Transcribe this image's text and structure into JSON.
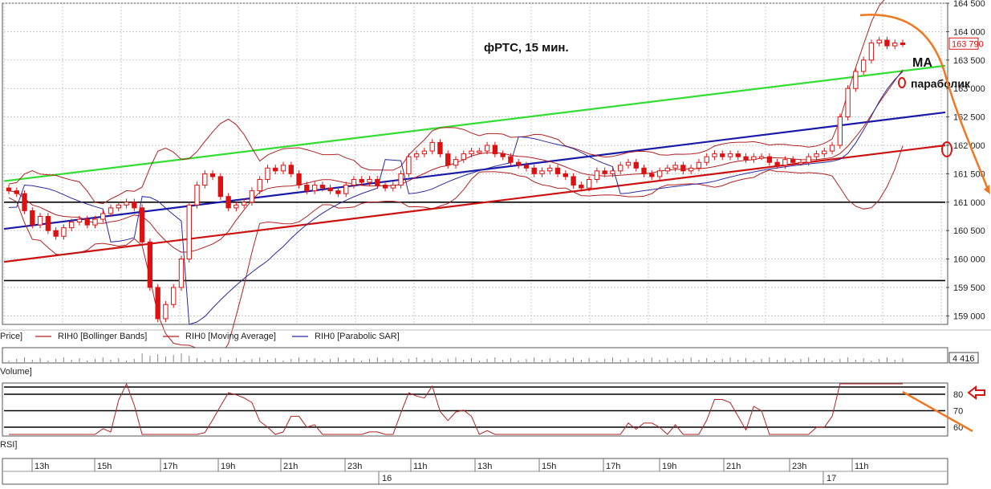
{
  "title": "фРТС,  15 мин.",
  "annotations": {
    "ma": "MA",
    "parabolic": "параболик"
  },
  "last_price_label": "163 790",
  "volume_value": "4 416",
  "panel_labels": {
    "price": "Price]",
    "volume": "Volume]",
    "rsi": "RSI]"
  },
  "legend": [
    {
      "label": "RIH0 [Bollinger Bands]",
      "color": "#b22222"
    },
    {
      "label": "RIH0 [Moving Average]",
      "color": "#b22222"
    },
    {
      "label": "RIH0 [Parabolic SAR]",
      "color": "#2a2aa0"
    }
  ],
  "time_axis": {
    "hours": [
      "13h",
      "15h",
      "17h",
      "19h",
      "21h",
      "23h",
      "11h",
      "13h",
      "15h",
      "17h",
      "19h",
      "21h",
      "23h",
      "11h"
    ],
    "days": [
      "16",
      "17"
    ]
  },
  "colors": {
    "candle": "#dd1111",
    "bollinger": "#b22222",
    "sar": "#2a2aa0",
    "green_trend": "#33dd33",
    "blue_trend": "#1a1aa8",
    "red_trend": "#cc1111",
    "orange_arrow": "#ee7722"
  },
  "chart_data": [
    {
      "type": "candlestick",
      "name": "price",
      "ylim": [
        158850,
        164500
      ],
      "y_ticks": [
        "164 500",
        "164 000",
        "163 500",
        "163 000",
        "162 500",
        "162 000",
        "161 500",
        "161 000",
        "160 500",
        "160 000",
        "159 500",
        "159 000"
      ],
      "horizontal_levels": [
        161000,
        159620
      ],
      "closes": [
        161200,
        161150,
        160850,
        160600,
        160750,
        160500,
        160400,
        160550,
        160650,
        160700,
        160600,
        160700,
        160800,
        160900,
        160950,
        161000,
        160900,
        160300,
        159500,
        158950,
        159200,
        159500,
        160000,
        160950,
        161300,
        161500,
        161450,
        161100,
        160900,
        160950,
        161000,
        161200,
        161400,
        161600,
        161550,
        161650,
        161500,
        161300,
        161200,
        161300,
        161250,
        161200,
        161150,
        161300,
        161400,
        161350,
        161400,
        161300,
        161250,
        161300,
        161500,
        161800,
        161850,
        161900,
        162050,
        161850,
        161650,
        161750,
        161850,
        161900,
        161900,
        162000,
        161850,
        161800,
        161700,
        161650,
        161600,
        161500,
        161550,
        161600,
        161500,
        161450,
        161300,
        161250,
        161400,
        161550,
        161500,
        161550,
        161650,
        161700,
        161600,
        161500,
        161450,
        161550,
        161600,
        161650,
        161550,
        161600,
        161700,
        161800,
        161850,
        161800,
        161850,
        161800,
        161750,
        161800,
        161800,
        161700,
        161650,
        161750,
        161700,
        161700,
        161800,
        161850,
        161900,
        162000,
        162500,
        163000,
        163300,
        163500,
        163800,
        163850,
        163750,
        163800,
        163790
      ],
      "moving_average_end": 163450,
      "parabolic_sar_end": 163050,
      "trend_lines": [
        {
          "name": "green",
          "from": 161370,
          "to": 163400
        },
        {
          "name": "blue",
          "from": 160530,
          "to": 162580
        },
        {
          "name": "red",
          "from": 159950,
          "to": 162000
        }
      ]
    },
    {
      "type": "bar",
      "name": "volume",
      "last_value": 4416
    },
    {
      "type": "line",
      "name": "RSI",
      "y_ticks": [
        "80",
        "70",
        "60"
      ],
      "levels": [
        80,
        70,
        60
      ],
      "end_value": 81
    }
  ]
}
